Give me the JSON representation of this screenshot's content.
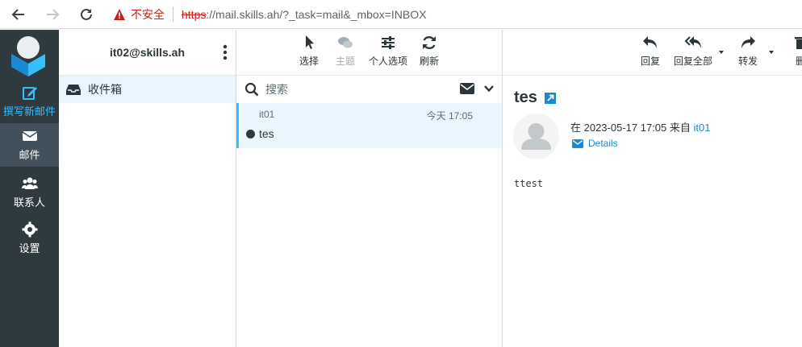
{
  "browser": {
    "insecure_label": "不安全",
    "url_scheme": "https",
    "url_rest": "://mail.skills.ah/?_task=mail&_mbox=INBOX"
  },
  "nav": {
    "compose": "撰写新邮件",
    "mail": "邮件",
    "contacts": "联系人",
    "settings": "设置"
  },
  "folders": {
    "account": "it02@skills.ah",
    "items": [
      {
        "label": "收件箱"
      }
    ]
  },
  "list_toolbar": {
    "select": "选择",
    "threads": "主题",
    "options": "个人选项",
    "refresh": "刷新"
  },
  "search": {
    "placeholder": "搜索"
  },
  "messages": [
    {
      "from": "it01",
      "date": "今天 17:05",
      "subject": "tes"
    }
  ],
  "read_toolbar": {
    "reply": "回复",
    "reply_all": "回复全部",
    "forward": "转发",
    "delete_partial": "删"
  },
  "message": {
    "subject": "tes",
    "meta_prefix": "在 2023-05-17 17:05 来自 ",
    "sender": "it01",
    "details": "Details",
    "body": "ttest"
  },
  "colors": {
    "accent": "#37beff",
    "link": "#1a8ad1",
    "nav_bg": "#2f3a3f",
    "selected_bg": "#e9f6fd",
    "insecure": "#c5221f"
  }
}
